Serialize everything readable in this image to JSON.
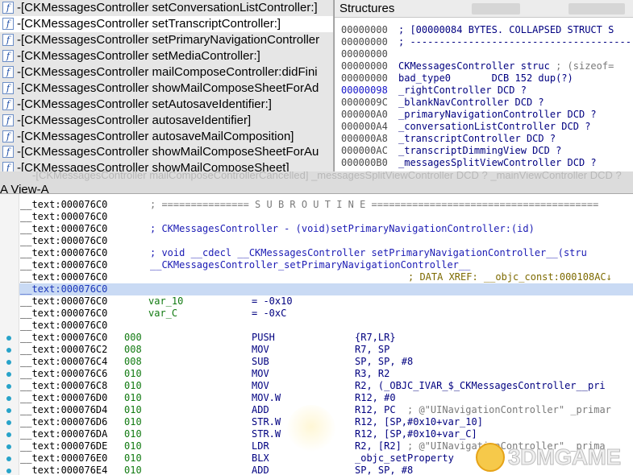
{
  "functions": {
    "icon_glyph": "f",
    "items": [
      {
        "label": "-[CKMessagesController setConversationListController:]",
        "selected": false
      },
      {
        "label": "-[CKMessagesController setTranscriptController:]",
        "selected": true
      },
      {
        "label": "-[CKMessagesController setPrimaryNavigationController",
        "selected": false
      },
      {
        "label": "-[CKMessagesController setMediaController:]",
        "selected": false
      },
      {
        "label": "-[CKMessagesController mailComposeController:didFini",
        "selected": false
      },
      {
        "label": "-[CKMessagesController showMailComposeSheetForAd",
        "selected": false
      },
      {
        "label": "-[CKMessagesController setAutosaveIdentifier:]",
        "selected": false
      },
      {
        "label": "-[CKMessagesController autosaveIdentifier]",
        "selected": false
      },
      {
        "label": "-[CKMessagesController autosaveMailComposition]",
        "selected": false
      },
      {
        "label": "-[CKMessagesController showMailComposeSheetForAu",
        "selected": false
      },
      {
        "label": "-[CKMessagesController showMailComposeSheet]",
        "selected": false
      }
    ]
  },
  "structures": {
    "title": "Structures",
    "lines": [
      {
        "addr": "00000000",
        "text": "; [00000084 BYTES. COLLAPSED STRUCT S"
      },
      {
        "addr": "00000000",
        "text": "; ----------------------------------------"
      },
      {
        "addr": "00000000",
        "text": ""
      },
      {
        "addr": "00000000",
        "text": "CKMessagesController struc ",
        "comment": "; (sizeof="
      },
      {
        "addr": "00000000",
        "text": "bad_type0       DCB 152 dup(?)"
      },
      {
        "addr": "00000098",
        "text": "_rightController DCD ?",
        "blue": true
      },
      {
        "addr": "0000009C",
        "text": "_blankNavController DCD ?"
      },
      {
        "addr": "000000A0",
        "text": "_primaryNavigationController DCD ?"
      },
      {
        "addr": "000000A4",
        "text": "_conversationListController DCD ?"
      },
      {
        "addr": "000000A8",
        "text": "_transcriptController DCD ?"
      },
      {
        "addr": "000000AC",
        "text": "_transcriptDimmingView DCD ?"
      },
      {
        "addr": "000000B0",
        "text": "_messagesSplitViewController DCD ?"
      }
    ]
  },
  "splitter": {
    "ghost_text": "-[CKMessagesController mailComposeControllerCancelled]        _messagesSplitViewController DCD ?     _mainViewController DCD ?",
    "view_tab": "A View-A"
  },
  "disasm": {
    "rows": [
      {
        "addr": "__text:000076C0",
        "kind": "sep",
        "text": "; =============== S U B R O U T I N E ======================================="
      },
      {
        "addr": "__text:000076C0",
        "kind": "blank"
      },
      {
        "addr": "__text:000076C0",
        "kind": "comment",
        "text": "; CKMessagesController - (void)setPrimaryNavigationController:(id)"
      },
      {
        "addr": "__text:000076C0",
        "kind": "blank"
      },
      {
        "addr": "__text:000076C0",
        "kind": "comment",
        "text": "; void __cdecl __CKMessagesController setPrimaryNavigationController__(stru"
      },
      {
        "addr": "__text:000076C0",
        "kind": "comment",
        "text": "__CKMessagesController_setPrimaryNavigationController__"
      },
      {
        "addr": "__text:000076C0",
        "kind": "xref",
        "text": "; DATA XREF: __objc_const:000108AC↓"
      },
      {
        "addr": "__text:000076C0",
        "kind": "blank",
        "selected": true
      },
      {
        "addr": "__text:000076C0",
        "kind": "var",
        "name": "var_10",
        "value": "= -0x10"
      },
      {
        "addr": "__text:000076C0",
        "kind": "var",
        "name": "var_C",
        "value": "= -0xC"
      },
      {
        "addr": "__text:000076C0",
        "kind": "blank"
      },
      {
        "addr": "__text:000076C0",
        "kind": "insn",
        "sp": "000",
        "mn": "PUSH",
        "op": "{R7,LR}",
        "dot": true
      },
      {
        "addr": "__text:000076C2",
        "kind": "insn",
        "sp": "008",
        "mn": "MOV",
        "op": "R7, SP",
        "dot": true
      },
      {
        "addr": "__text:000076C4",
        "kind": "insn",
        "sp": "008",
        "mn": "SUB",
        "op": "SP, SP, #8",
        "dot": true
      },
      {
        "addr": "__text:000076C6",
        "kind": "insn",
        "sp": "010",
        "mn": "MOV",
        "op": "R3, R2",
        "dot": true
      },
      {
        "addr": "__text:000076C8",
        "kind": "insn",
        "sp": "010",
        "mn": "MOV",
        "op": "R2, (_OBJC_IVAR_$_CKMessagesController__pri",
        "dot": true
      },
      {
        "addr": "__text:000076D0",
        "kind": "insn",
        "sp": "010",
        "mn": "MOV.W",
        "op": "R12, #0",
        "dot": true
      },
      {
        "addr": "__text:000076D4",
        "kind": "insn",
        "sp": "010",
        "mn": "ADD",
        "op": "R12, PC",
        "tail": "  ; @\"UINavigationController\" _primar",
        "dot": true
      },
      {
        "addr": "__text:000076D6",
        "kind": "insn",
        "sp": "010",
        "mn": "STR.W",
        "op": "R12, [SP,#0x10+var_10]",
        "dot": true
      },
      {
        "addr": "__text:000076DA",
        "kind": "insn",
        "sp": "010",
        "mn": "STR.W",
        "op": "R12, [SP,#0x10+var_C]",
        "dot": true
      },
      {
        "addr": "__text:000076DE",
        "kind": "insn",
        "sp": "010",
        "mn": "LDR",
        "op": "R2, [R2]",
        "tail": " ; @\"UINavigationController\" _prima",
        "dot": true
      },
      {
        "addr": "__text:000076E0",
        "kind": "insn",
        "sp": "010",
        "mn": "BLX",
        "op": "_objc_setProperty",
        "dot": true
      },
      {
        "addr": "__text:000076E4",
        "kind": "insn",
        "sp": "010",
        "mn": "ADD",
        "op": "SP, SP, #8",
        "dot": true
      }
    ]
  },
  "watermark": {
    "text": "3DMGAME"
  },
  "colors": {
    "selection": "#c9daf4",
    "addr_highlight": "#1a36b8",
    "xref": "#7d6a00",
    "stack": "#117a11"
  }
}
